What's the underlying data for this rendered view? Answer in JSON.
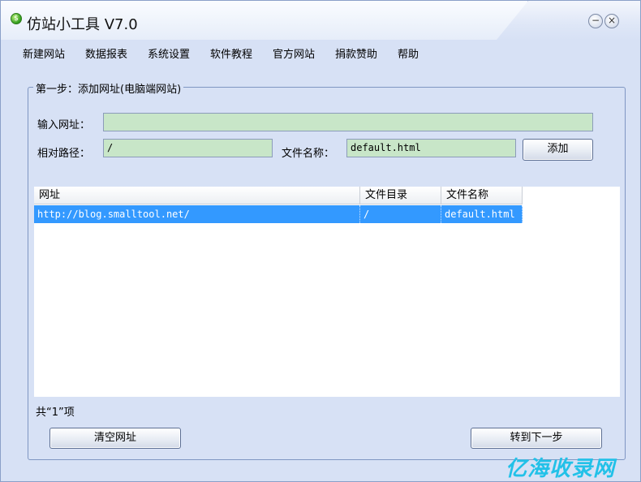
{
  "window": {
    "title": "仿站小工具 V7.0",
    "min_label": "−",
    "close_label": "×",
    "app_icon_glyph": "$"
  },
  "menu": {
    "items": [
      "新建网站",
      "数据报表",
      "系统设置",
      "软件教程",
      "官方网站",
      "捐款赞助",
      "帮助"
    ]
  },
  "step1": {
    "legend": "第一步：添加网址(电脑端网站)",
    "url_label": "输入网址：",
    "url_value": "",
    "path_label": "相对路径：",
    "path_value": "/",
    "filename_label": "文件名称：",
    "filename_value": "default.html",
    "add_button": "添加"
  },
  "table": {
    "columns": [
      "网址",
      "文件目录",
      "文件名称"
    ],
    "rows": [
      [
        "http://blog.smalltool.net/",
        "/",
        "default.html"
      ]
    ]
  },
  "footer": {
    "count_text": "共“1”项",
    "clear_button": "清空网址",
    "next_button": "转到下一步"
  },
  "watermark": {
    "text": "亿海收录网"
  },
  "colors": {
    "window_bg": "#d7e1f5",
    "field_bg": "#c8e6c8",
    "selection": "#3399ff",
    "watermark": "#22c1e8"
  }
}
